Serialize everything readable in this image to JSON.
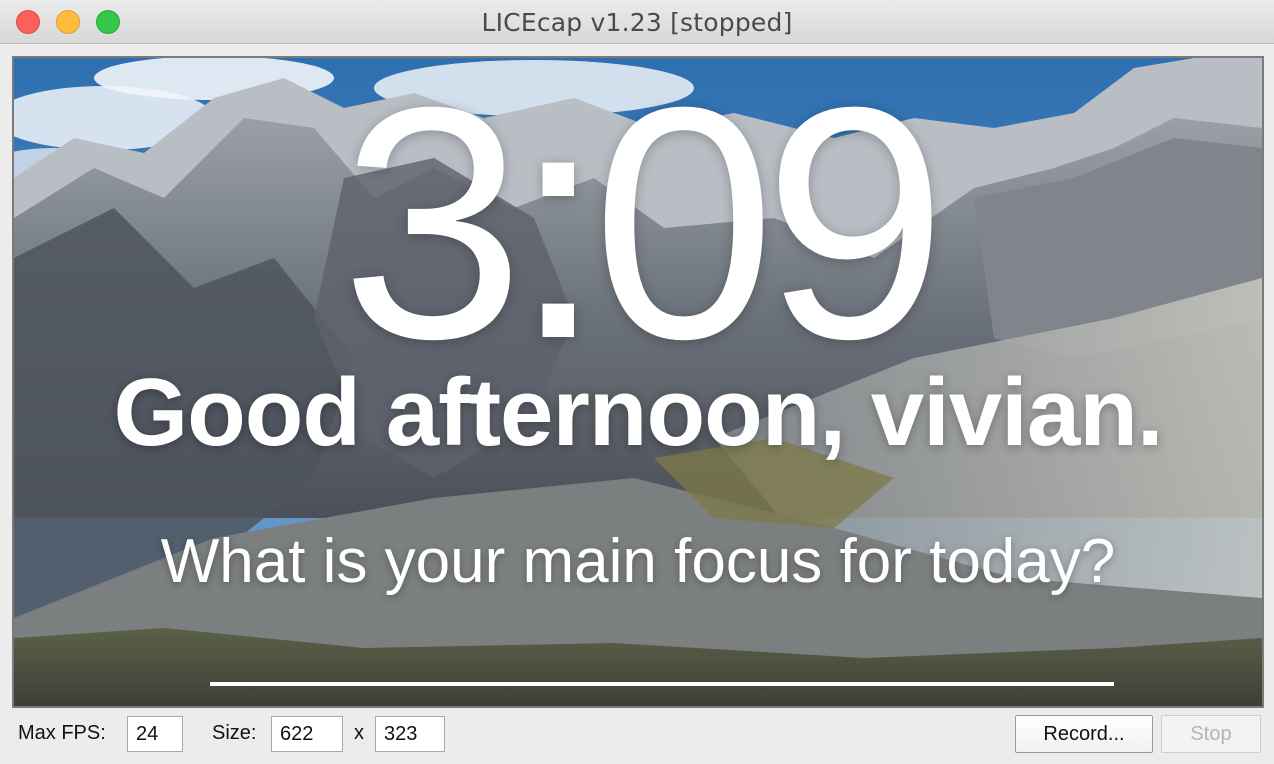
{
  "window": {
    "title": "LICEcap v1.23 [stopped]"
  },
  "capture": {
    "clock": "3:09",
    "greeting": "Good afternoon, vivian.",
    "question": "What is your main focus for today?",
    "focus_value": ""
  },
  "controls": {
    "max_fps_label": "Max FPS:",
    "max_fps_value": "24",
    "size_label": "Size:",
    "width_value": "622",
    "size_separator": "x",
    "height_value": "323",
    "record_label": "Record...",
    "stop_label": "Stop"
  },
  "colors": {
    "close": "#fc605c",
    "minimize": "#fdbc40",
    "maximize": "#34c84a"
  }
}
